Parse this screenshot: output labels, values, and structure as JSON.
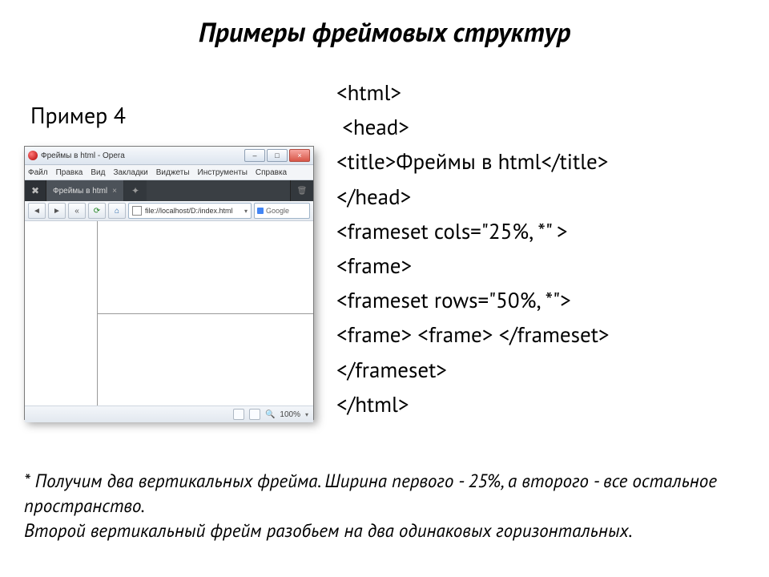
{
  "title": "Примеры фреймовых структур",
  "example_label": "Пример 4",
  "browser": {
    "window_title": "Фреймы в html - Opera",
    "menu": [
      "Файл",
      "Правка",
      "Вид",
      "Закладки",
      "Виджеты",
      "Инструменты",
      "Справка"
    ],
    "tab_label": "Фреймы в html",
    "url": "file://localhost/D:/index.html",
    "search_label": "Google",
    "zoom": "100%"
  },
  "code": {
    "l1": "<html>",
    "l2": " <head>",
    "l3": "<title>Фреймы в html</title>",
    "l4": "</head>",
    "l5": "<frameset cols=\"25%, *\" >",
    "l6": "<frame>",
    "l7": "<frameset rows=\"50%, *\">",
    "l8": "<frame> <frame> </frameset>",
    "l9": "</frameset>",
    "l10": "</html>"
  },
  "footnote": {
    "p1": "* Получим два вертикальных фрейма. Ширина первого - 25%, а второго - все остальное пространство.",
    "p2": "Второй вертикальный фрейм разобьем на два одинаковых горизонтальных."
  }
}
